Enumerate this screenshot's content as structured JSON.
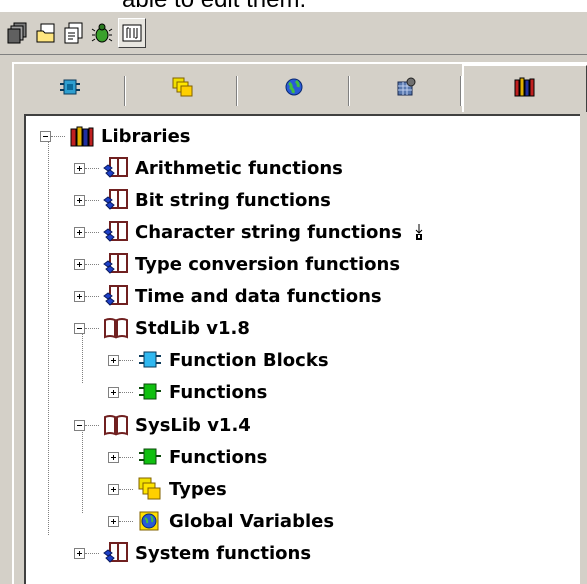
{
  "header_fragment": "able to edit them.",
  "toolbar": {
    "buttons": [
      {
        "icon": "pou-icon"
      },
      {
        "icon": "folder-icon"
      },
      {
        "icon": "visualization-icon"
      },
      {
        "icon": "bug-icon"
      },
      {
        "icon": "resources-icon"
      }
    ]
  },
  "tabs": [
    {
      "icon": "function-block-icon"
    },
    {
      "icon": "types-icon"
    },
    {
      "icon": "globe-icon"
    },
    {
      "icon": "configuration-icon"
    },
    {
      "icon": "library-icon",
      "active": true
    }
  ],
  "tree": {
    "root": "Libraries",
    "items": [
      {
        "label": "Arithmetic functions"
      },
      {
        "label": "Bit string functions"
      },
      {
        "label": "Character string functions"
      },
      {
        "label": "Type conversion functions"
      },
      {
        "label": "Time and data functions"
      },
      {
        "label": "StdLib v1.8"
      },
      {
        "label": "Function Blocks"
      },
      {
        "label": "Functions"
      },
      {
        "label": "SysLib v1.4"
      },
      {
        "label": "Functions"
      },
      {
        "label": "Types"
      },
      {
        "label": "Global Variables"
      },
      {
        "label": "System functions"
      }
    ]
  },
  "colors": {
    "panel": "#d4d0c8",
    "tree_bg": "#ffffff",
    "accent_blue": "#1e40c8"
  }
}
